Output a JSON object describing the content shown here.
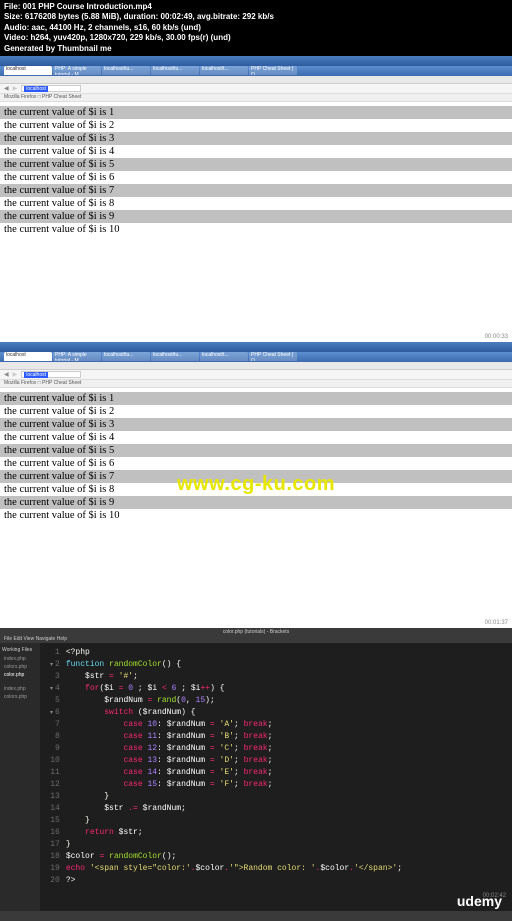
{
  "meta": {
    "line1": "File: 001 PHP Course Introduction.mp4",
    "line2": "Size: 6176208 bytes (5.88 MiB), duration: 00:02:49, avg.bitrate: 292 kb/s",
    "line3": "Audio: aac, 44100 Hz, 2 channels, s16, 60 kb/s (und)",
    "line4": "Video: h264, yuv420p, 1280x720, 229 kb/s, 30.00 fps(r) (und)",
    "line5": "Generated by Thumbnail me"
  },
  "browser": {
    "tabs": [
      "localhost",
      "PHP: A simple tutorial - M...",
      "localhost/tu...",
      "localhost/tu...",
      "localhost/t...",
      "PHP Cheat Sheet | O..."
    ],
    "url_highlight": "localhost",
    "bookmarks": "Mozilla Firefox    □ PHP Cheat Sheet",
    "timestamp1": "00:00:33",
    "timestamp2": "00:01:37"
  },
  "php_output": [
    "the current value of $i is 1",
    "the current value of $i is 2",
    "the current value of $i is 3",
    "the current value of $i is 4",
    "the current value of $i is 5",
    "the current value of $i is 6",
    "the current value of $i is 7",
    "the current value of $i is 8",
    "the current value of $i is 9",
    "the current value of $i is 10"
  ],
  "watermark": "www.cg-ku.com",
  "editor": {
    "title": "color.php (tutorials) - Brackets",
    "menu": "File  Edit  View  Navigate  Help",
    "sidebar_header": "Working Files",
    "sidebar_items": [
      "index.php",
      "colors.php",
      "color.php"
    ],
    "sidebar_below": [
      "index.php",
      "colors.php"
    ],
    "code_lines": [
      {
        "n": 1,
        "a": "",
        "html": "<span class='tk-plain'>&lt;?php</span>"
      },
      {
        "n": 2,
        "a": "▾",
        "html": "<span class='tk-fn'>function</span> <span class='tk-name'>randomColor</span><span class='tk-plain'>() {</span>"
      },
      {
        "n": 3,
        "a": "",
        "html": "    <span class='tk-var'>$str</span> <span class='tk-op'>=</span> <span class='tk-str'>'#'</span><span class='tk-plain'>;</span>"
      },
      {
        "n": 4,
        "a": "▾",
        "html": "    <span class='tk-kw'>for</span><span class='tk-plain'>(</span><span class='tk-var'>$i</span> <span class='tk-op'>=</span> <span class='tk-num'>0</span> <span class='tk-plain'>;</span> <span class='tk-var'>$i</span> <span class='tk-op'>&lt;</span> <span class='tk-num'>6</span> <span class='tk-plain'>;</span> <span class='tk-var'>$i</span><span class='tk-op'>++</span><span class='tk-plain'>) {</span>"
      },
      {
        "n": 5,
        "a": "",
        "html": "        <span class='tk-var'>$randNum</span> <span class='tk-op'>=</span> <span class='tk-name'>rand</span><span class='tk-plain'>(</span><span class='tk-num'>0</span><span class='tk-plain'>,</span> <span class='tk-num'>15</span><span class='tk-plain'>);</span>"
      },
      {
        "n": 6,
        "a": "▾",
        "html": "        <span class='tk-kw'>switch</span> <span class='tk-plain'>(</span><span class='tk-var'>$randNum</span><span class='tk-plain'>) {</span>"
      },
      {
        "n": 7,
        "a": "",
        "html": "            <span class='tk-kw'>case</span> <span class='tk-num'>10</span><span class='tk-plain'>:</span> <span class='tk-var'>$randNum</span> <span class='tk-op'>=</span> <span class='tk-str'>'A'</span><span class='tk-plain'>;</span> <span class='tk-kw'>break</span><span class='tk-plain'>;</span>"
      },
      {
        "n": 8,
        "a": "",
        "html": "            <span class='tk-kw'>case</span> <span class='tk-num'>11</span><span class='tk-plain'>:</span> <span class='tk-var'>$randNum</span> <span class='tk-op'>=</span> <span class='tk-str'>'B'</span><span class='tk-plain'>;</span> <span class='tk-kw'>break</span><span class='tk-plain'>;</span>"
      },
      {
        "n": 9,
        "a": "",
        "html": "            <span class='tk-kw'>case</span> <span class='tk-num'>12</span><span class='tk-plain'>:</span> <span class='tk-var'>$randNum</span> <span class='tk-op'>=</span> <span class='tk-str'>'C'</span><span class='tk-plain'>;</span> <span class='tk-kw'>break</span><span class='tk-plain'>;</span>"
      },
      {
        "n": 10,
        "a": "",
        "html": "            <span class='tk-kw'>case</span> <span class='tk-num'>13</span><span class='tk-plain'>:</span> <span class='tk-var'>$randNum</span> <span class='tk-op'>=</span> <span class='tk-str'>'D'</span><span class='tk-plain'>;</span> <span class='tk-kw'>break</span><span class='tk-plain'>;</span>"
      },
      {
        "n": 11,
        "a": "",
        "html": "            <span class='tk-kw'>case</span> <span class='tk-num'>14</span><span class='tk-plain'>:</span> <span class='tk-var'>$randNum</span> <span class='tk-op'>=</span> <span class='tk-str'>'E'</span><span class='tk-plain'>;</span> <span class='tk-kw'>break</span><span class='tk-plain'>;</span>"
      },
      {
        "n": 12,
        "a": "",
        "html": "            <span class='tk-kw'>case</span> <span class='tk-num'>15</span><span class='tk-plain'>:</span> <span class='tk-var'>$randNum</span> <span class='tk-op'>=</span> <span class='tk-str'>'F'</span><span class='tk-plain'>;</span> <span class='tk-kw'>break</span><span class='tk-plain'>;</span>"
      },
      {
        "n": 13,
        "a": "",
        "html": "        <span class='tk-plain'>}</span>"
      },
      {
        "n": 14,
        "a": "",
        "html": "        <span class='tk-var'>$str</span> <span class='tk-op'>.=</span> <span class='tk-var'>$randNum</span><span class='tk-plain'>;</span>"
      },
      {
        "n": 15,
        "a": "",
        "html": "    <span class='tk-plain'>}</span>"
      },
      {
        "n": 16,
        "a": "",
        "html": "    <span class='tk-kw'>return</span> <span class='tk-var'>$str</span><span class='tk-plain'>;</span>"
      },
      {
        "n": 17,
        "a": "",
        "html": "<span class='tk-plain'>}</span>"
      },
      {
        "n": 18,
        "a": "",
        "html": "<span class='tk-var'>$color</span> <span class='tk-op'>=</span> <span class='tk-name'>randomColor</span><span class='tk-plain'>();</span>"
      },
      {
        "n": 19,
        "a": "",
        "html": "<span class='tk-kw'>echo</span> <span class='tk-str'>'&lt;span style=\"color:'</span><span class='tk-op'>.</span><span class='tk-var'>$color</span><span class='tk-op'>.</span><span class='tk-str'>'\"&gt;Random color: '</span><span class='tk-op'>.</span><span class='tk-var'>$color</span><span class='tk-op'>.</span><span class='tk-str'>'&lt;/span&gt;'</span><span class='tk-plain'>;</span>"
      },
      {
        "n": 20,
        "a": "",
        "html": "<span class='tk-plain'>?&gt;</span>"
      }
    ],
    "timestamp": "00:02:42",
    "brand": "udemy"
  }
}
